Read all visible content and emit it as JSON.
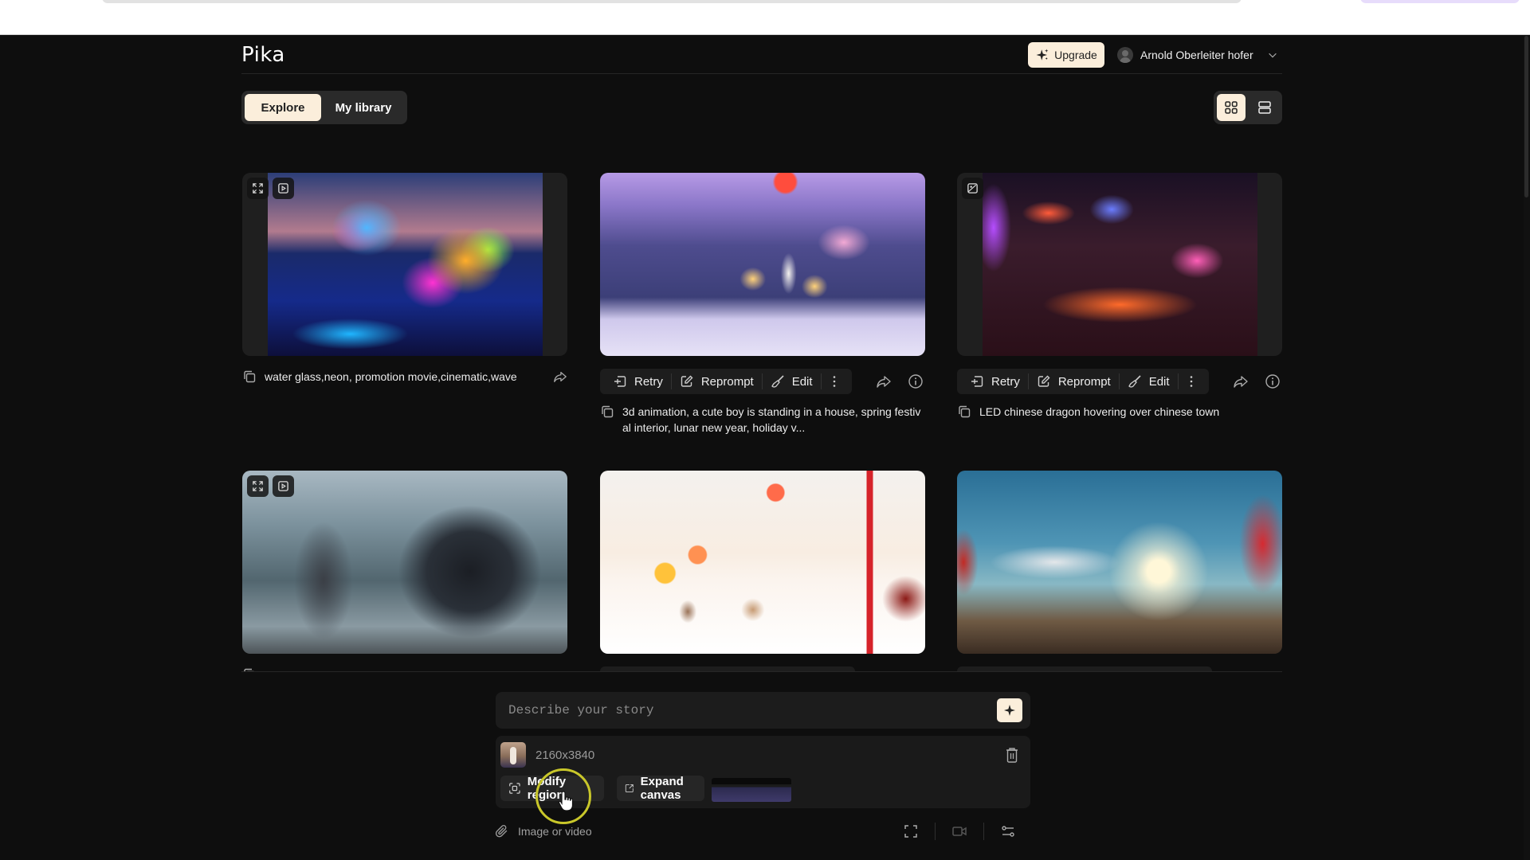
{
  "app": {
    "logo": "Pika",
    "upgrade_label": "Upgrade",
    "user_name": "Arnold Oberleiter hofer",
    "accent_color": "#fbeedb"
  },
  "tabs": [
    {
      "label": "Explore",
      "active": true
    },
    {
      "label": "My library",
      "active": false
    }
  ],
  "view_modes": [
    {
      "icon": "grid-view-icon",
      "active": true
    },
    {
      "icon": "list-view-icon",
      "active": false
    }
  ],
  "cards": [
    {
      "caption": "water glass,neon, promotion movie,cinematic,wave",
      "overlay_icons": [
        "expand-icon",
        "video-icon"
      ],
      "has_actions": false
    },
    {
      "caption": "3d animation, a cute boy is standing in a house, spring festival interior, lunar new year, holiday v...",
      "caption_line1": "3d animation, a cute boy is standing in a house, spring festiv",
      "caption_line2": "al interior, lunar new year, holiday v...",
      "has_actions": true
    },
    {
      "caption": "LED chinese dragon hovering over chinese town",
      "overlay_icons": [
        "image-icon"
      ],
      "has_actions": true
    },
    {
      "caption": "",
      "overlay_icons": [
        "expand-icon",
        "video-icon"
      ]
    },
    {
      "caption": ""
    },
    {
      "caption": ""
    }
  ],
  "actions": {
    "retry": "Retry",
    "reprompt": "Reprompt",
    "edit": "Edit"
  },
  "prompt": {
    "placeholder": "Describe your story",
    "value": ""
  },
  "attachment": {
    "dimensions": "2160x3840",
    "modify_region": "Modify region",
    "expand_canvas": "Expand canvas"
  },
  "toolbar": {
    "attach_label": "Image or video"
  }
}
